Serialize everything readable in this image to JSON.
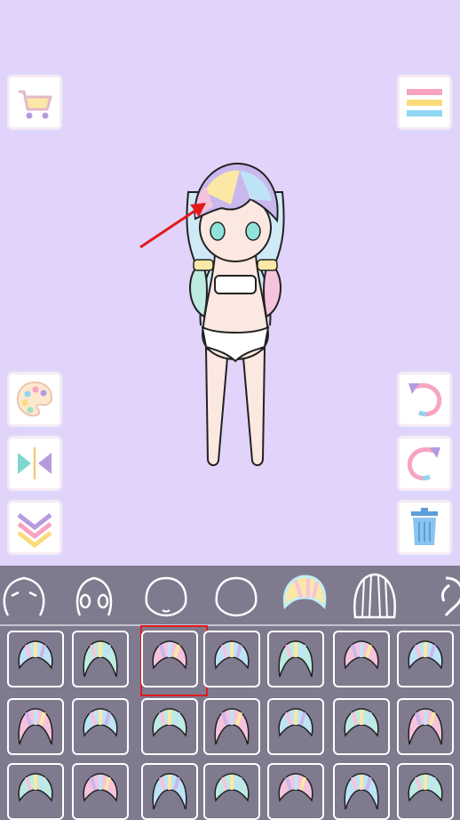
{
  "colors": {
    "stage_bg": "#e2d3fb",
    "panel_bg": "#807a8f",
    "highlight": "#e4191c",
    "arrow": "#e4191c"
  },
  "left_buttons": [
    {
      "icon": "shopping-cart-icon"
    },
    {
      "icon": "palette-icon"
    },
    {
      "icon": "flip-icon"
    },
    {
      "icon": "collapse-icon"
    }
  ],
  "right_buttons": [
    {
      "icon": "menu-icon"
    },
    {
      "icon": "undo-icon"
    },
    {
      "icon": "redo-icon"
    },
    {
      "icon": "trash-icon"
    }
  ],
  "categories": [
    {
      "icon": "face-eyes-icon"
    },
    {
      "icon": "face-ears-icon"
    },
    {
      "icon": "face-mouth-icon"
    },
    {
      "icon": "face-outline-icon"
    },
    {
      "icon": "hair-front-icon",
      "selected": true
    },
    {
      "icon": "hair-back-icon"
    },
    {
      "icon": "hair-side-icon"
    }
  ],
  "hair_items_count": 21,
  "selected_hair_index": 2
}
